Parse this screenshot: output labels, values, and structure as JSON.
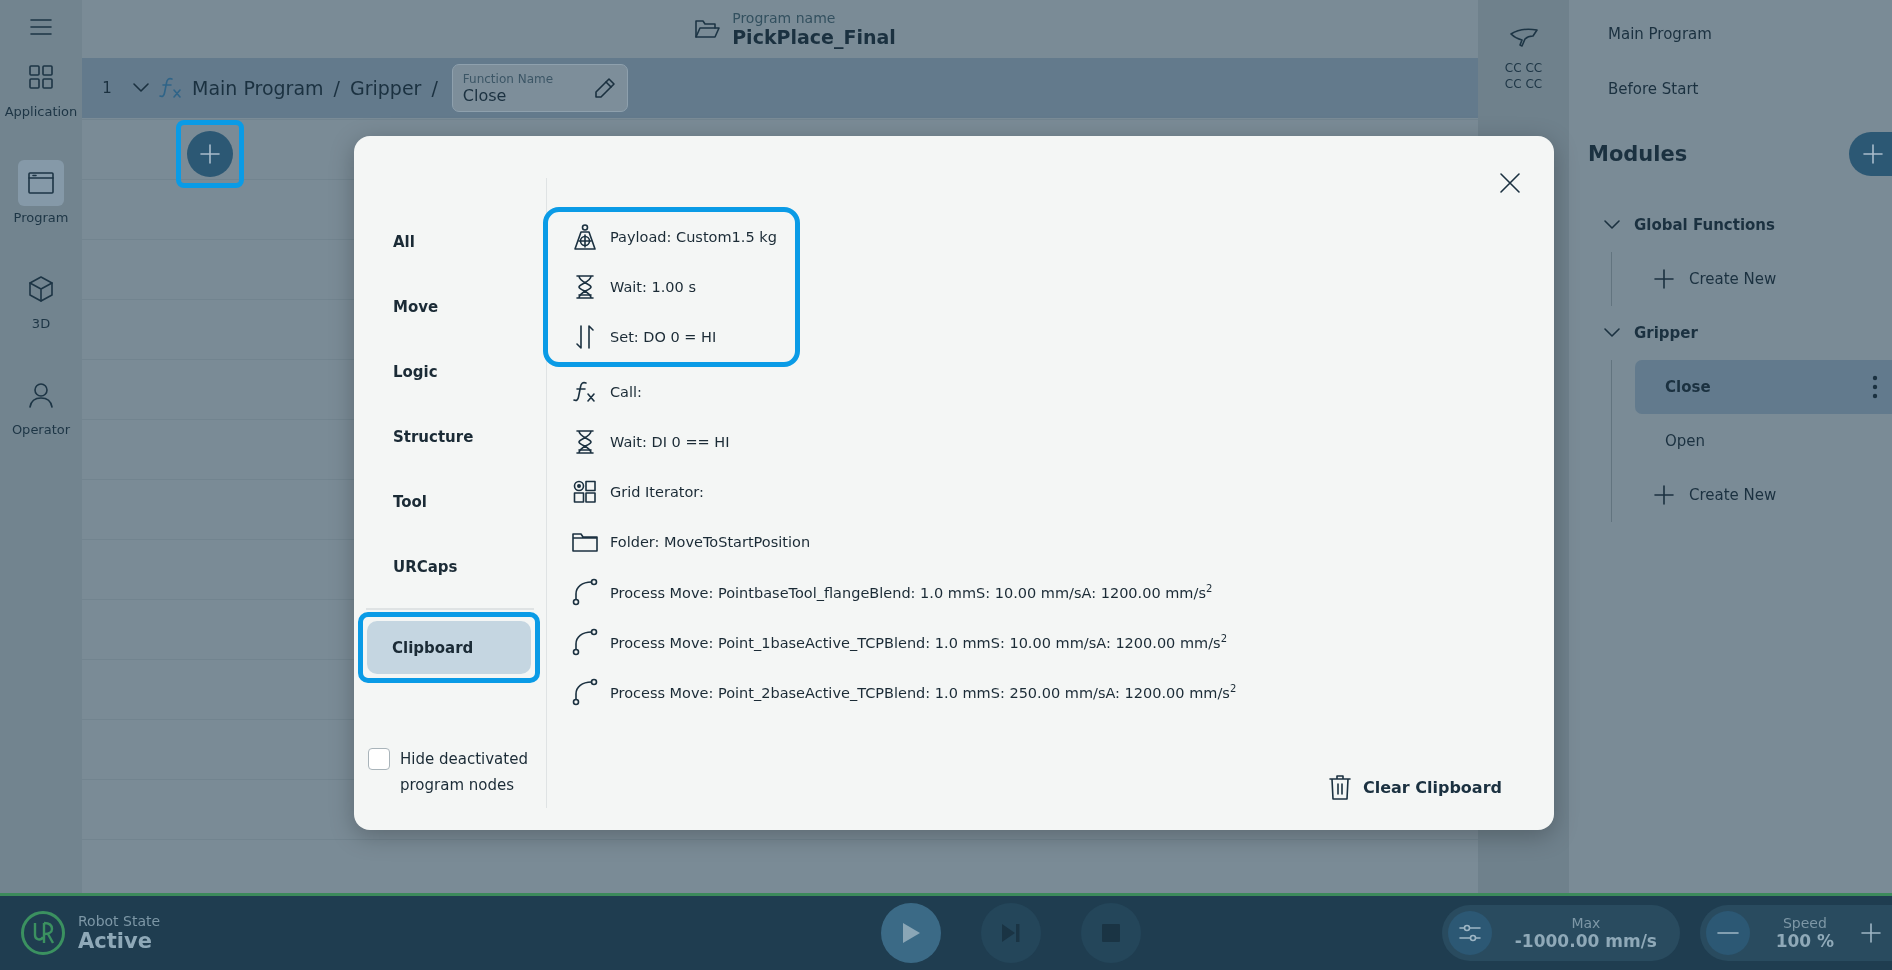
{
  "nav": {
    "items": [
      {
        "label": "Application",
        "selected": false
      },
      {
        "label": "Program",
        "selected": true
      },
      {
        "label": "3D",
        "selected": false
      },
      {
        "label": "Operator",
        "selected": false
      }
    ]
  },
  "program": {
    "name_label": "Program name",
    "name": "PickPlace_Final"
  },
  "node": {
    "number": "1",
    "expanded": true,
    "path": [
      "Main Program",
      "Gripper"
    ],
    "separator": "/",
    "field": {
      "label": "Function Name",
      "value": "Close"
    },
    "add_highlighted": true
  },
  "tool_panel": {
    "lines": [
      "CC CC",
      "CC CC"
    ]
  },
  "sidebar": {
    "items": [
      {
        "label": "Main Program",
        "selected": false
      },
      {
        "label": "Before Start",
        "selected": false
      }
    ],
    "modules_title": "Modules",
    "modules": [
      {
        "label": "Global Functions",
        "expanded": true,
        "children": [
          {
            "label": "Create New",
            "kind": "create",
            "selected": false
          }
        ]
      },
      {
        "label": "Gripper",
        "expanded": true,
        "children": [
          {
            "label": "Close",
            "kind": "function",
            "selected": true
          },
          {
            "label": "Open",
            "kind": "function",
            "selected": false
          },
          {
            "label": "Create New",
            "kind": "create",
            "selected": false
          }
        ]
      }
    ]
  },
  "dialog": {
    "categories": [
      {
        "label": "All",
        "kind": "filter",
        "selected": false,
        "highlighted": false
      },
      {
        "label": "Move",
        "kind": "filter",
        "selected": false,
        "highlighted": false
      },
      {
        "label": "Logic",
        "kind": "filter",
        "selected": false,
        "highlighted": false
      },
      {
        "label": "Structure",
        "kind": "filter",
        "selected": false,
        "highlighted": false
      },
      {
        "label": "Tool",
        "kind": "filter",
        "selected": false,
        "highlighted": false
      },
      {
        "label": "URCaps",
        "kind": "filter",
        "selected": false,
        "highlighted": false
      },
      {
        "label": "Clipboard",
        "kind": "clipboard",
        "selected": true,
        "highlighted": true
      }
    ],
    "hide_deactivated": {
      "label": "Hide deactivated program nodes",
      "checked": false
    },
    "items": [
      {
        "kind": "payload",
        "text": "Payload: Custom1.5 kg",
        "highlighted": true
      },
      {
        "kind": "wait",
        "text": "Wait: 1.00 s",
        "highlighted": true
      },
      {
        "kind": "set",
        "text": "Set: DO 0 = HI",
        "highlighted": true
      },
      {
        "kind": "call",
        "text": "Call:",
        "highlighted": false
      },
      {
        "kind": "wait",
        "text": "Wait: DI 0 == HI",
        "highlighted": false
      },
      {
        "kind": "grid",
        "text": "Grid Iterator:",
        "highlighted": false
      },
      {
        "kind": "folder",
        "text": "Folder: MoveToStartPosition",
        "highlighted": false
      },
      {
        "kind": "move",
        "text": "Process Move: PointbaseTool_flangeBlend: 1.0 mmS: 10.00 mm/sA: 1200.00 mm/s$^{2}$",
        "highlighted": false
      },
      {
        "kind": "move",
        "text": "Process Move: Point_1baseActive_TCPBlend: 1.0 mmS: 10.00 mm/sA: 1200.00 mm/s$^{2}$",
        "highlighted": false
      },
      {
        "kind": "move",
        "text": "Process Move: Point_2baseActive_TCPBlend: 1.0 mmS: 250.00 mm/sA: 1200.00 mm/s$^{2}$",
        "highlighted": false
      }
    ],
    "clear_button": "Clear Clipboard"
  },
  "status_bar": {
    "robot_state_label": "Robot State",
    "robot_state": "Active",
    "max_label": "Max",
    "max_value": "-1000.00 mm/s",
    "speed_label": "Speed",
    "speed_value": "100 %"
  }
}
